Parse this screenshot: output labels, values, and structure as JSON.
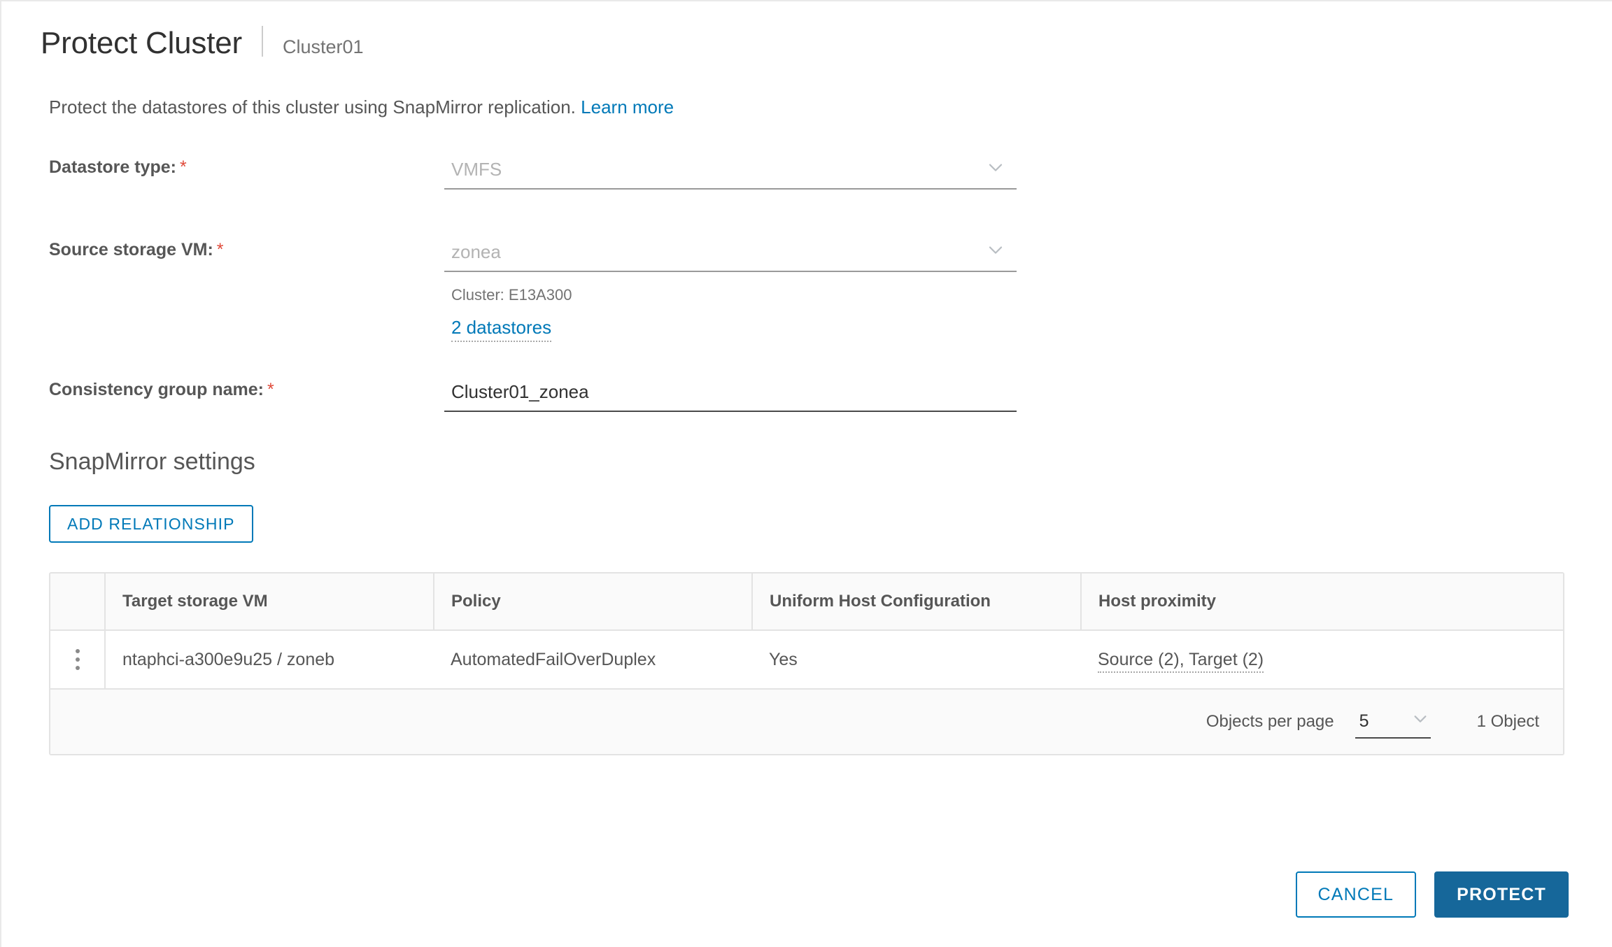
{
  "header": {
    "title": "Protect Cluster",
    "subtitle": "Cluster01"
  },
  "intro": {
    "text": "Protect the datastores of this cluster using SnapMirror replication.",
    "link_label": "Learn more"
  },
  "form": {
    "datastore_type": {
      "label": "Datastore type:",
      "required_marker": "*",
      "value": "VMFS"
    },
    "source_storage_vm": {
      "label": "Source storage VM:",
      "required_marker": "*",
      "value": "zonea",
      "cluster_hint": "Cluster: E13A300",
      "datastores_link": "2 datastores"
    },
    "consistency_group_name": {
      "label": "Consistency group name:",
      "required_marker": "*",
      "value": "Cluster01_zonea",
      "placeholder": ""
    }
  },
  "snapmirror": {
    "section_title": "SnapMirror settings",
    "add_relationship_label": "ADD RELATIONSHIP",
    "table": {
      "columns": [
        "Target storage VM",
        "Policy",
        "Uniform Host Configuration",
        "Host proximity"
      ],
      "rows": [
        {
          "target_storage_vm": "ntaphci-a300e9u25 / zoneb",
          "policy": "AutomatedFailOverDuplex",
          "uniform_host_configuration": "Yes",
          "host_proximity": "Source (2), Target (2)"
        }
      ],
      "footer": {
        "objects_per_page_label": "Objects per page",
        "objects_per_page_value": "5",
        "object_count": "1 Object"
      }
    }
  },
  "footer": {
    "cancel_label": "CANCEL",
    "protect_label": "PROTECT"
  },
  "colors": {
    "link": "#0079b8",
    "primary_button": "#16679a",
    "required_asterisk": "#e04a3a",
    "label_text": "#565656",
    "title_text": "#313131"
  }
}
